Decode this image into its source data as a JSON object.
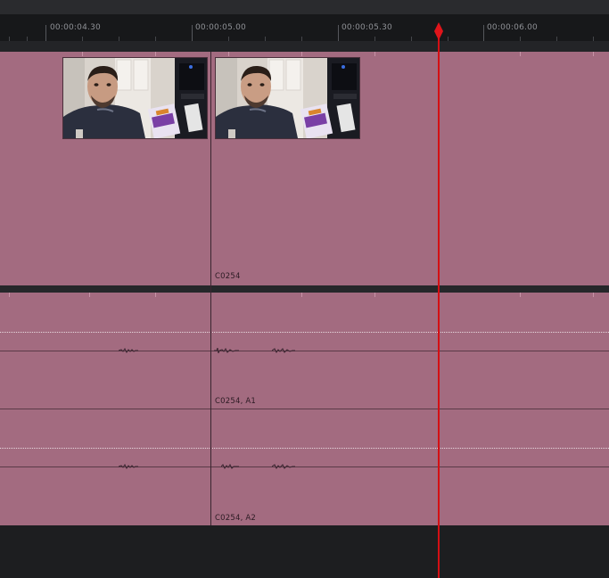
{
  "timeline": {
    "timecodes": [
      "00:00:04.30",
      "00:00:05.00",
      "00:00:05.30",
      "00:00:06.00"
    ],
    "video_track": {
      "clip_name": "C0254"
    },
    "audio_tracks": [
      {
        "clip_name": "C0254, A1"
      },
      {
        "clip_name": "C0254, A2"
      }
    ]
  },
  "colors": {
    "clip": "#a36b80",
    "playhead": "#d40f14",
    "background": "#1d1e20"
  }
}
